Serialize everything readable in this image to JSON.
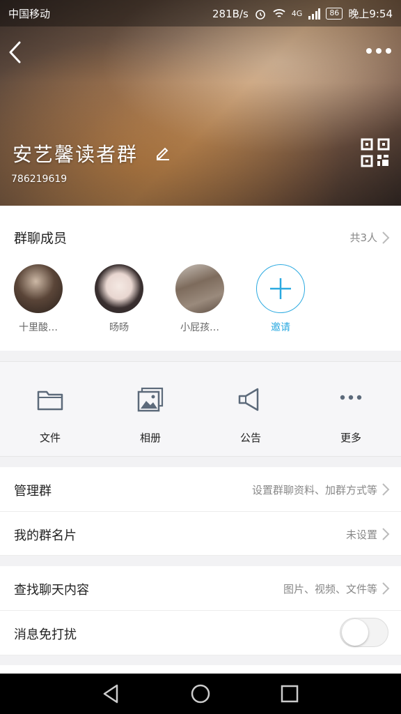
{
  "status_bar": {
    "carrier": "中国移动",
    "net_speed": "281B/s",
    "network": "4G",
    "battery": "86",
    "time": "晚上9:54"
  },
  "header": {
    "group_name": "安艺馨读者群",
    "group_id": "786219619"
  },
  "members": {
    "title": "群聊成员",
    "count": "共3人",
    "list": [
      {
        "name": "十里酸…"
      },
      {
        "name": "旸旸"
      },
      {
        "name": "小屁孩…"
      }
    ],
    "invite_label": "邀请"
  },
  "actions": [
    {
      "label": "文件",
      "icon": "folder-icon"
    },
    {
      "label": "相册",
      "icon": "photo-album-icon"
    },
    {
      "label": "公告",
      "icon": "megaphone-icon"
    },
    {
      "label": "更多",
      "icon": "more-dots-icon"
    }
  ],
  "settings": {
    "manage": {
      "label": "管理群",
      "value": "设置群聊资料、加群方式等"
    },
    "card": {
      "label": "我的群名片",
      "value": "未设置"
    },
    "search": {
      "label": "查找聊天内容",
      "value": "图片、视频、文件等"
    },
    "mute": {
      "label": "消息免打扰",
      "enabled": false
    }
  },
  "colors": {
    "accent": "#2aa9e0"
  }
}
